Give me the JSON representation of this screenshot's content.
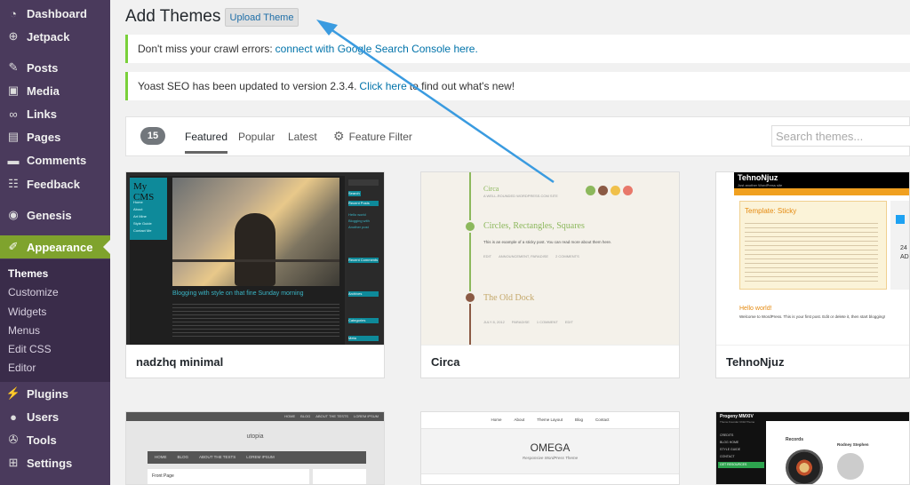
{
  "sidebar": {
    "items": [
      {
        "label": "Dashboard",
        "icon": "dashboard-icon"
      },
      {
        "label": "Jetpack",
        "icon": "jetpack-icon"
      },
      {
        "label": "Posts",
        "icon": "pin-icon"
      },
      {
        "label": "Media",
        "icon": "media-icon"
      },
      {
        "label": "Links",
        "icon": "link-icon"
      },
      {
        "label": "Pages",
        "icon": "page-icon"
      },
      {
        "label": "Comments",
        "icon": "comment-icon"
      },
      {
        "label": "Feedback",
        "icon": "feedback-icon"
      },
      {
        "label": "Genesis",
        "icon": "genesis-icon"
      },
      {
        "label": "Appearance",
        "icon": "brush-icon"
      },
      {
        "label": "Plugins",
        "icon": "plugin-icon"
      },
      {
        "label": "Users",
        "icon": "user-icon"
      },
      {
        "label": "Tools",
        "icon": "wrench-icon"
      },
      {
        "label": "Settings",
        "icon": "settings-icon"
      }
    ],
    "submenu": [
      "Themes",
      "Customize",
      "Widgets",
      "Menus",
      "Edit CSS",
      "Editor"
    ],
    "accent_color": "#7fa32d"
  },
  "header": {
    "title": "Add Themes",
    "upload_label": "Upload Theme"
  },
  "notices": [
    {
      "prefix": "Don't miss your crawl errors:",
      "link": "connect with Google Search Console here.",
      "suffix": ""
    },
    {
      "prefix": "Yoast SEO has been updated to version 2.3.4.",
      "link": "Click here",
      "suffix": "to find out what's new!"
    }
  ],
  "filter": {
    "count": "15",
    "tabs": [
      "Featured",
      "Popular",
      "Latest"
    ],
    "feature_filter": "Feature Filter",
    "search_placeholder": "Search themes..."
  },
  "themes": [
    {
      "name": "nadzhq minimal",
      "logo": "My CMS",
      "post_title": "Blogging with style on that fine Sunday morning",
      "nav_items": [
        "Home",
        "About",
        "Art Mine",
        "Style Guide",
        "Contact Me"
      ],
      "widget_items": [
        "Search",
        "Recent Posts",
        "Hello world",
        "Blogging with",
        "Another post",
        "Recent Comments",
        "Archives",
        "Categories",
        "Meta"
      ]
    },
    {
      "name": "Circa",
      "site_title": "Circa",
      "tagline": "A WELL-ROUNDED WORDPRESS.COM SITE",
      "post1_title": "Circles, Rectangles, Squares",
      "post1_excerpt": "This is an example of a sticky post. You can read more about them here.",
      "post1_meta": [
        "EDIT",
        "ANNOUNCEMENT, PARADISE",
        "2 COMMENTS"
      ],
      "post2_title": "The Old Dock",
      "post2_meta": [
        "JULY 8, 2012",
        "PARADISE",
        "1 COMMENT",
        "EDIT"
      ]
    },
    {
      "name": "TehnoNjuz",
      "site_title": "TehnoNjuz",
      "tagline": "Just another WordPress site",
      "sticky_title": "Template: Sticky",
      "hello_title": "Hello world!",
      "hello_text": "Welcome to WordPress. This is your first post. Edit or delete it, then start blogging!",
      "side_text": [
        "24",
        "AD"
      ]
    },
    {
      "name": "utopia",
      "site_title": "utopia",
      "nav_items": [
        "HOME",
        "BLOG",
        "ABOUT THE TESTS",
        "LOREM IPSUM"
      ],
      "top_nav": [
        "HOME",
        "BLOG",
        "ABOUT THE TESTS",
        "LOREM IPSUM"
      ],
      "widget_title": "Front Page"
    },
    {
      "name": "OMEGA",
      "site_title": "OMEGA",
      "tagline": "Responsive WordPress Theme",
      "nav_items": [
        "Home",
        "About",
        "Theme Layout",
        "Blog",
        "Contact"
      ]
    },
    {
      "name": "Progeny MMXIV",
      "site_title": "Progeny MMXIV",
      "tagline": "Theme Founder Child Theme",
      "nav_items": [
        "CREDITS",
        "BLOG HOME",
        "STYLE GUIDE",
        "CONTACT",
        "GET RESOURCES"
      ],
      "heading": "Records",
      "card_title": "Rodney Stephen"
    }
  ]
}
